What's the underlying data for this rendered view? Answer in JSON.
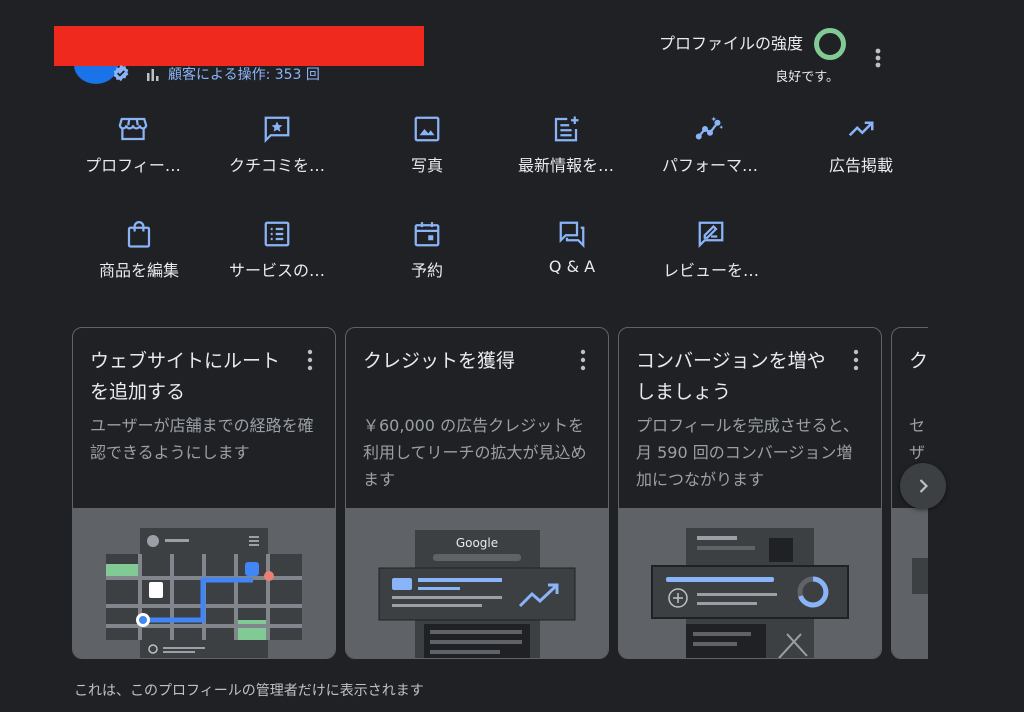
{
  "header": {
    "interactions_text": "顧客による操作: 353 回",
    "profile_strength_label": "プロファイルの強度",
    "profile_strength_status": "良好です。"
  },
  "icons": {
    "bar_chart": "bar-chart-icon",
    "verified": "verified-badge-icon",
    "more": "more-vert-icon",
    "next": "chevron-right-icon"
  },
  "colors": {
    "background": "#202124",
    "accent_blue": "#8ab4f8",
    "strength_ring": "#81c995",
    "redaction": "#f0291f"
  },
  "actions": [
    {
      "label": "プロフィー…",
      "icon": "storefront-icon"
    },
    {
      "label": "クチコミを…",
      "icon": "star-review-icon"
    },
    {
      "label": "写真",
      "icon": "image-icon"
    },
    {
      "label": "最新情報を…",
      "icon": "post-add-icon"
    },
    {
      "label": "パフォーマ…",
      "icon": "insights-icon"
    },
    {
      "label": "広告掲載",
      "icon": "trending-up-icon"
    },
    {
      "label": "商品を編集",
      "icon": "shopping-bag-icon"
    },
    {
      "label": "サービスの…",
      "icon": "list-alt-icon"
    },
    {
      "label": "予約",
      "icon": "calendar-icon"
    },
    {
      "label": "Q & A",
      "icon": "question-answer-icon"
    },
    {
      "label": "レビューを…",
      "icon": "rate-review-icon"
    }
  ],
  "cards": [
    {
      "title": "ウェブサイトにルートを追加する",
      "description": "ユーザーが店舗までの経路を確認できるようにします",
      "illustration": "map-route-illustration"
    },
    {
      "title": "クレジットを獲得",
      "description": "￥60,000 の広告クレジットを利用してリーチの拡大が見込めます",
      "illustration": "google-ad-illustration",
      "illustration_text": "Google"
    },
    {
      "title": "コンバージョンを増やしましょう",
      "description": "プロフィールを完成させると、月 590 回のコンバージョン増加につながります",
      "illustration": "profile-completion-illustration"
    },
    {
      "title": "ク",
      "description": "セザ",
      "illustration": "partial-illustration"
    }
  ],
  "footer": {
    "note": "これは、このプロフィールの管理者だけに表示されます"
  }
}
